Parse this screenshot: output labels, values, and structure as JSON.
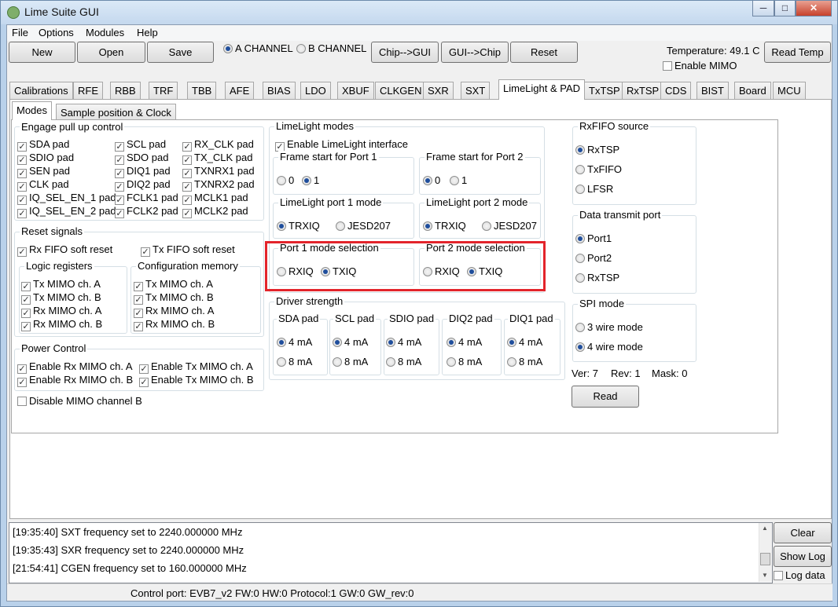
{
  "window": {
    "title": "Lime Suite GUI",
    "buttons": [
      "0",
      "1",
      "r"
    ]
  },
  "menu": [
    "File",
    "Options",
    "Modules",
    "Help"
  ],
  "toolbar": {
    "new": "New",
    "open": "Open",
    "save": "Save",
    "channel_a": "A CHANNEL",
    "channel_b": "B CHANNEL",
    "chip_to_gui": "Chip-->GUI",
    "gui_to_chip": "GUI-->Chip",
    "reset": "Reset",
    "temperature": "Temperature: 49.1 C",
    "read_temp": "Read Temp",
    "enable_mimo": "Enable MIMO"
  },
  "tabs": [
    "Calibrations",
    "RFE",
    "RBB",
    "TRF",
    "TBB",
    "AFE",
    "BIAS",
    "LDO",
    "XBUF",
    "CLKGEN",
    "SXR",
    "SXT",
    "LimeLight & PAD",
    "TxTSP",
    "RxTSP",
    "CDS",
    "BIST",
    "Board",
    "MCU"
  ],
  "subtabs": [
    "Modes",
    "Sample position & Clock"
  ],
  "pullup": {
    "title": "Engage pull up control",
    "col1": [
      "SDA pad",
      "SDIO pad",
      "SEN pad",
      "CLK pad",
      "IQ_SEL_EN_1 pad",
      "IQ_SEL_EN_2 pad"
    ],
    "col2": [
      "SCL pad",
      "SDO pad",
      "DIQ1 pad",
      "DIQ2 pad",
      "FCLK1 pad",
      "FCLK2 pad"
    ],
    "col3": [
      "RX_CLK pad",
      "TX_CLK pad",
      "TXNRX1 pad",
      "TXNRX2 pad",
      "MCLK1 pad",
      "MCLK2 pad"
    ]
  },
  "reset": {
    "title": "Reset signals",
    "rx_fifo": "Rx FIFO soft reset",
    "tx_fifo": "Tx FIFO soft reset",
    "logic_title": "Logic registers",
    "config_title": "Configuration memory",
    "logic": [
      "Tx MIMO ch. A",
      "Tx MIMO ch. B",
      "Rx MIMO ch. A",
      "Rx MIMO ch. B"
    ],
    "config": [
      "Tx MIMO ch. A",
      "Tx MIMO ch. B",
      "Rx MIMO ch. A",
      "Rx MIMO ch. B"
    ]
  },
  "power": {
    "title": "Power Control",
    "items": [
      "Enable Rx MIMO ch. A",
      "Enable Tx MIMO ch. A",
      "Enable Rx MIMO ch. B",
      "Enable Tx MIMO ch. B"
    ],
    "disable_b": "Disable MIMO channel B"
  },
  "limelight": {
    "title": "LimeLight modes",
    "enable": "Enable LimeLight interface",
    "fs1_title": "Frame start for Port 1",
    "fs2_title": "Frame start for Port 2",
    "opt0": "0",
    "opt1": "1",
    "p1mode_title": "LimeLight port 1 mode",
    "p2mode_title": "LimeLight port 2 mode",
    "trxiq": "TRXIQ",
    "jesd": "JESD207",
    "p1sel_title": "Port 1 mode selection",
    "p2sel_title": "Port 2 mode selection",
    "rxiq": "RXIQ",
    "txiq": "TXIQ"
  },
  "driver": {
    "title": "Driver strength",
    "pads": [
      "SDA pad",
      "SCL pad",
      "SDIO pad",
      "DIQ2 pad",
      "DIQ1 pad"
    ],
    "opt4": "4 mA",
    "opt8": "8 mA"
  },
  "rxfifo": {
    "title": "RxFIFO source",
    "options": [
      "RxTSP",
      "TxFIFO",
      "LFSR"
    ]
  },
  "txport": {
    "title": "Data transmit port",
    "options": [
      "Port1",
      "Port2",
      "RxTSP"
    ]
  },
  "spi": {
    "title": "SPI mode",
    "options": [
      "3 wire mode",
      "4 wire mode"
    ]
  },
  "version": {
    "ver": "Ver: 7",
    "rev": "Rev: 1",
    "mask": "Mask: 0",
    "read": "Read"
  },
  "log": {
    "lines": [
      "[19:35:40] SXT frequency set to 2240.000000 MHz",
      "[19:35:43] SXR frequency set to 2240.000000 MHz",
      "[21:54:41] CGEN frequency set to 160.000000 MHz"
    ],
    "clear": "Clear",
    "show_log": "Show Log",
    "log_data": "Log data"
  },
  "status": "Control port: EVB7_v2 FW:0 HW:0 Protocol:1 GW:0 GW_rev:0"
}
